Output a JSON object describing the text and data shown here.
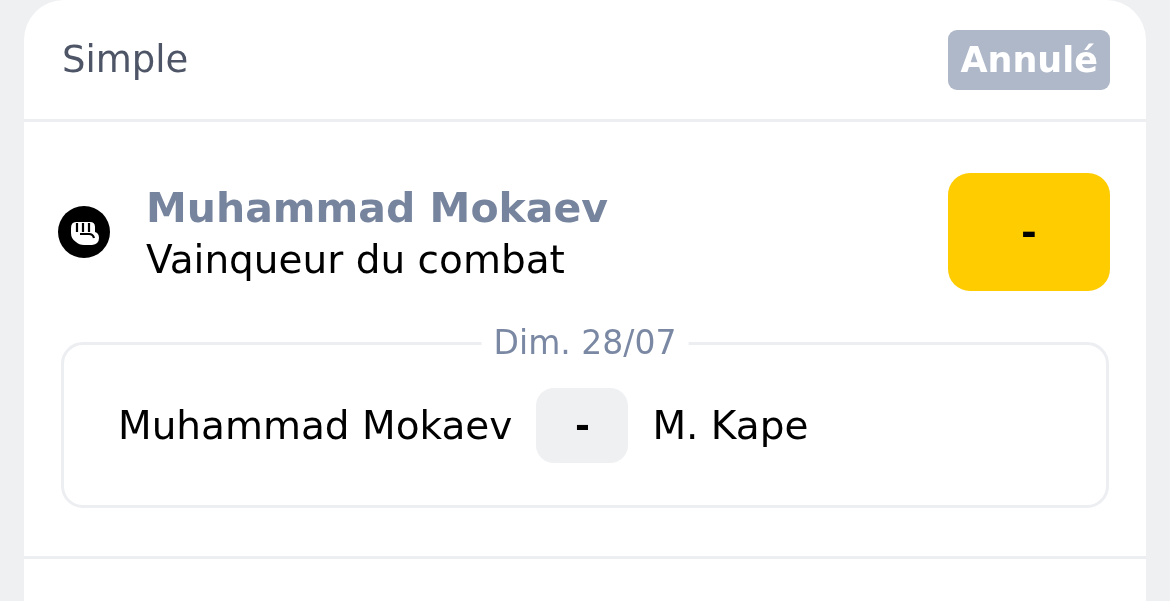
{
  "bet": {
    "type": "Simple",
    "status": {
      "label": "Annulé",
      "kind": "cancelled"
    }
  },
  "selection": {
    "name": "Muhammad Mokaev",
    "market": "Vainqueur du combat",
    "odds": "-"
  },
  "event": {
    "date": "Dim. 28/07",
    "home": "Muhammad Mokaev",
    "score": "-",
    "away": "M. Kape"
  }
}
